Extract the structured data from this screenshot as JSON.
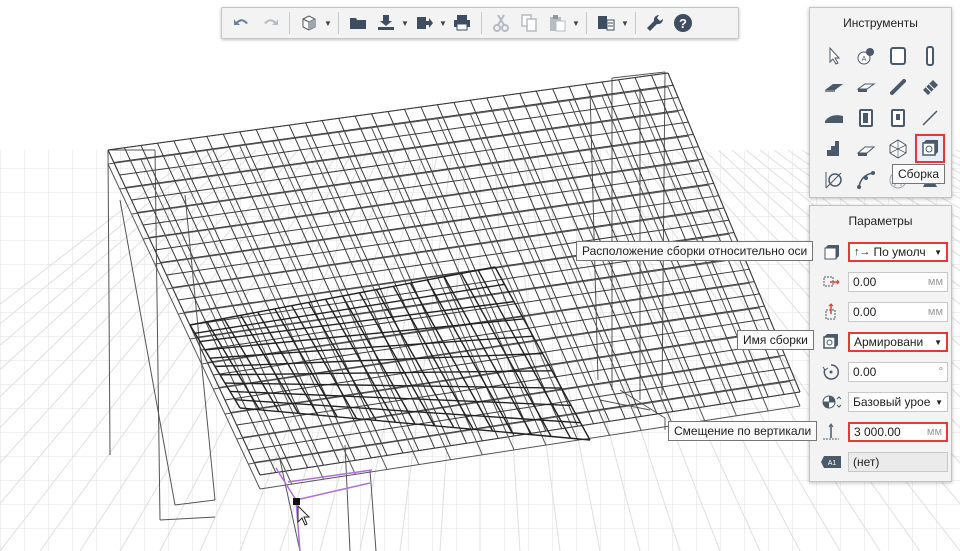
{
  "tools_panel": {
    "title": "Инструменты",
    "tooltip": "Сборка",
    "items": [
      "select",
      "annotation",
      "wall",
      "column",
      "slab",
      "beam",
      "rebar",
      "profile",
      "roof",
      "door",
      "window",
      "line",
      "stair",
      "railing",
      "object",
      "assembly",
      "dimension",
      "curve",
      "mesh",
      "more"
    ]
  },
  "params_panel": {
    "title": "Параметры",
    "rows": [
      {
        "value": "По умолч",
        "tooltip": "Расположение сборки относительно оси"
      },
      {
        "value": "0.00",
        "unit": "мм"
      },
      {
        "value": "0.00",
        "unit": "мм"
      },
      {
        "value": "Армировани",
        "tooltip": "Имя сборки"
      },
      {
        "value": "0.00",
        "unit": "°"
      },
      {
        "value": "Базовый урое"
      },
      {
        "value": "3 000.00",
        "unit": "мм",
        "tooltip": "Смещение по вертикали"
      },
      {
        "value": "(нет)",
        "badge": "A1"
      }
    ]
  },
  "colors": {
    "highlight": "#e53935",
    "selection": "#b070e0",
    "grid": "#dcdcdc",
    "wire": "#333333"
  }
}
